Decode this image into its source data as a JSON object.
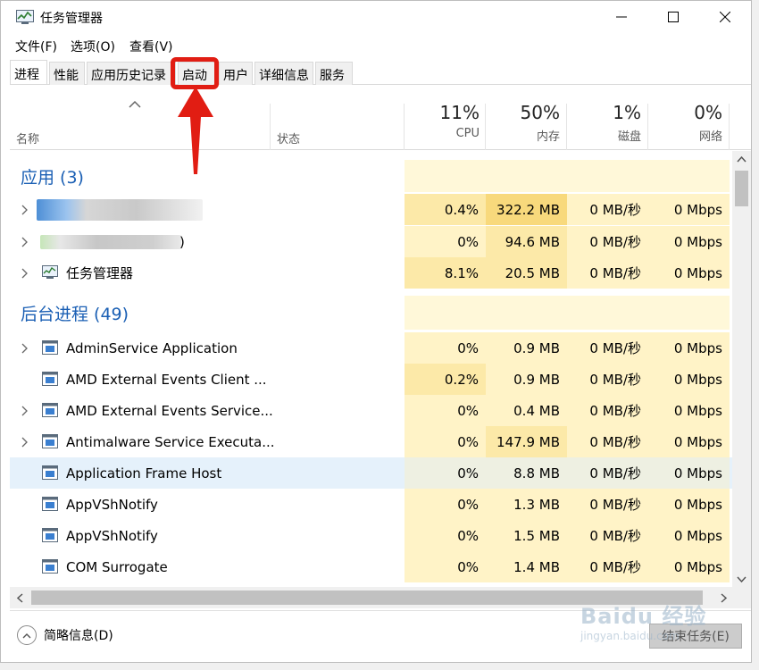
{
  "window": {
    "title": "任务管理器"
  },
  "menu": [
    "文件(F)",
    "选项(O)",
    "查看(V)"
  ],
  "tabs": [
    "进程",
    "性能",
    "应用历史记录",
    "启动",
    "用户",
    "详细信息",
    "服务"
  ],
  "active_tab": "进程",
  "highlighted_tab": "启动",
  "header": {
    "name": "名称",
    "status": "状态",
    "cpu": {
      "pct": "11%",
      "label": "CPU"
    },
    "mem": {
      "pct": "50%",
      "label": "内存"
    },
    "disk": {
      "pct": "1%",
      "label": "磁盘"
    },
    "net": {
      "pct": "0%",
      "label": "网络"
    }
  },
  "groups": {
    "apps": "应用 (3)",
    "background": "后台进程 (49)"
  },
  "apps": [
    {
      "name": "",
      "cpu": "0.4%",
      "mem": "322.2 MB",
      "disk": "0 MB/秒",
      "net": "0 Mbps"
    },
    {
      "name": ")",
      "cpu": "0%",
      "mem": "94.6 MB",
      "disk": "0 MB/秒",
      "net": "0 Mbps"
    },
    {
      "name": "任务管理器",
      "cpu": "8.1%",
      "mem": "20.5 MB",
      "disk": "0 MB/秒",
      "net": "0 Mbps"
    }
  ],
  "background": [
    {
      "name": "AdminService Application",
      "cpu": "0%",
      "mem": "0.9 MB",
      "disk": "0 MB/秒",
      "net": "0 Mbps"
    },
    {
      "name": "AMD External Events Client ...",
      "cpu": "0.2%",
      "mem": "0.9 MB",
      "disk": "0 MB/秒",
      "net": "0 Mbps"
    },
    {
      "name": "AMD External Events Service...",
      "cpu": "0%",
      "mem": "0.4 MB",
      "disk": "0 MB/秒",
      "net": "0 Mbps"
    },
    {
      "name": "Antimalware Service Executa...",
      "cpu": "0%",
      "mem": "147.9 MB",
      "disk": "0 MB/秒",
      "net": "0 Mbps"
    },
    {
      "name": "Application Frame Host",
      "cpu": "0%",
      "mem": "8.8 MB",
      "disk": "0 MB/秒",
      "net": "0 Mbps"
    },
    {
      "name": "AppVShNotify",
      "cpu": "0%",
      "mem": "1.3 MB",
      "disk": "0 MB/秒",
      "net": "0 Mbps"
    },
    {
      "name": "AppVShNotify",
      "cpu": "0%",
      "mem": "1.5 MB",
      "disk": "0 MB/秒",
      "net": "0 Mbps"
    },
    {
      "name": "COM Surrogate",
      "cpu": "0%",
      "mem": "1.4 MB",
      "disk": "0 MB/秒",
      "net": "0 Mbps"
    }
  ],
  "footer": {
    "brief": "简略信息(D)",
    "end_task": "结束任务(E)"
  },
  "watermark": {
    "big": "Baidu 经验",
    "small": "jingyan.baidu.com"
  },
  "colors": {
    "group_title": "#1a5fb4",
    "heat_light": "#fff4c4",
    "heat_mid": "#fdeeb0",
    "heat_strong": "#f9e08a",
    "selected_row": "#e5f1fb",
    "highlight_red": "#e11d13"
  }
}
